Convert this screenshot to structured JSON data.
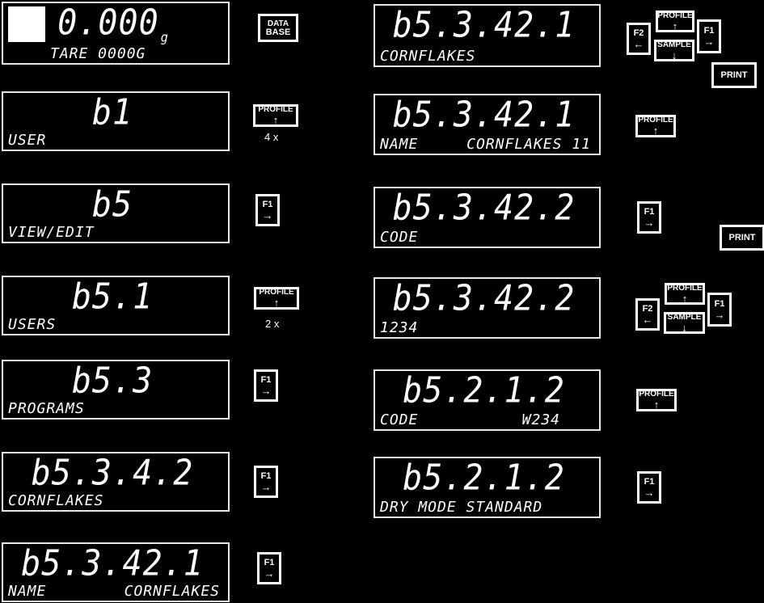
{
  "meta": {
    "title": "Balance LCD menu navigation sequence",
    "background_color": "#000000",
    "foreground_color": "#ffffff"
  },
  "displays": [
    {
      "id": "weighing-screen",
      "main": "0.000",
      "unit": "g",
      "sub_left": "TARE  0000",
      "sub_right": "G",
      "has_indicator_block": true
    },
    {
      "id": "user-menu",
      "main": "b1",
      "unit": "",
      "sub_left": "USER",
      "sub_right": "",
      "has_indicator_block": false
    },
    {
      "id": "view-edit-menu",
      "main": "b5",
      "unit": "",
      "sub_left": "VIEW/EDIT",
      "sub_right": "",
      "has_indicator_block": false
    },
    {
      "id": "users-submenu",
      "main": "b5.1",
      "unit": "",
      "sub_left": "USERS",
      "sub_right": "",
      "has_indicator_block": false
    },
    {
      "id": "programs-submenu",
      "main": "b5.3",
      "unit": "",
      "sub_left": "PROGRAMS",
      "sub_right": "",
      "has_indicator_block": false
    },
    {
      "id": "program-cornflakes",
      "main": "b5.3.4.2",
      "unit": "",
      "sub_left": "CORNFLAKES",
      "sub_right": "",
      "has_indicator_block": false
    },
    {
      "id": "name-cornflakes-left",
      "main": "b5.3.42.1",
      "unit": "",
      "sub_left": "NAME",
      "sub_right": "CORNFLAKES",
      "has_indicator_block": false
    },
    {
      "id": "cornflakes-edit",
      "main": "b5.3.42.1",
      "unit": "",
      "sub_left": "CORNFLAKES",
      "sub_right": "",
      "has_indicator_block": false
    },
    {
      "id": "name-cornflakes-cursor",
      "main": "b5.3.42.1",
      "unit": "",
      "sub_left": "NAME",
      "sub_right": "CORNFLAKES 11",
      "has_indicator_block": false
    },
    {
      "id": "code-menu",
      "main": "b5.3.42.2",
      "unit": "",
      "sub_left": "CODE",
      "sub_right": "",
      "has_indicator_block": false
    },
    {
      "id": "code-value",
      "main": "b5.3.42.2",
      "unit": "",
      "sub_left": "1234",
      "sub_right": "",
      "has_indicator_block": false
    },
    {
      "id": "code-w234",
      "main": "b5.2.1.2",
      "unit": "",
      "sub_left": "CODE",
      "sub_right": "W234",
      "has_indicator_block": false
    },
    {
      "id": "dry-mode-standard",
      "main": "b5.2.1.2",
      "unit": "",
      "sub_left": "DRY MODE STANDARD",
      "sub_right": "",
      "has_indicator_block": false
    }
  ],
  "keys": {
    "database": {
      "line1": "DATA",
      "line2": "BASE"
    },
    "profile_up": {
      "label": "PROFILE",
      "arrow": "↑"
    },
    "sample_down": {
      "label": "SAMPLE",
      "arrow": "↓"
    },
    "f1_right": {
      "label": "F1",
      "arrow": "→"
    },
    "f2_left": {
      "label": "F2",
      "arrow": "←"
    },
    "print": {
      "label": "PRINT"
    }
  },
  "captions": {
    "repeat_4x": "4 x",
    "repeat_2x": "2 x"
  }
}
